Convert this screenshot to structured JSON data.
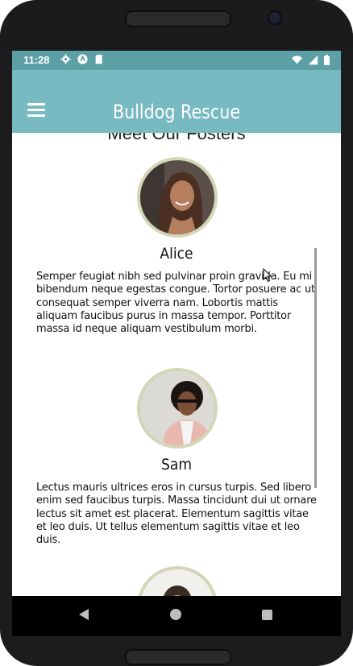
{
  "status_bar": {
    "time": "11:28",
    "left_icons": [
      "settings-icon",
      "logo-icon",
      "sd-card-icon"
    ],
    "right_icons": [
      "wifi-icon",
      "signal-icon",
      "battery-icon"
    ]
  },
  "app_bar": {
    "menu_icon": "hamburger-menu-icon",
    "title": "Bulldog Rescue",
    "color": "#78bac1"
  },
  "main": {
    "heading": "Meet Our Fosters",
    "fosters": [
      {
        "name": "Alice",
        "bio": "Semper feugiat nibh sed pulvinar proin gravida. Eu mi bibendum neque egestas congue. Tortor posuere ac ut consequat semper viverra nam. Lobortis mattis aliquam faucibus purus in massa tempor. Porttitor massa id neque aliquam vestibulum morbi."
      },
      {
        "name": "Sam",
        "bio": "Lectus mauris ultrices eros in cursus turpis. Sed libero enim sed faucibus turpis. Massa tincidunt dui ut ornare lectus sit amet est placerat. Elementum sagittis vitae et leo duis. Ut tellus elementum sagittis vitae et leo duis."
      },
      {
        "name": "",
        "bio": ""
      }
    ]
  },
  "nav_bar": {
    "back_icon": "back-triangle-icon",
    "home_icon": "home-circle-icon",
    "recent_icon": "recent-apps-square-icon"
  },
  "colors": {
    "status_bar": "#5c9fa5",
    "avatar_border": "#d3d6b7"
  }
}
